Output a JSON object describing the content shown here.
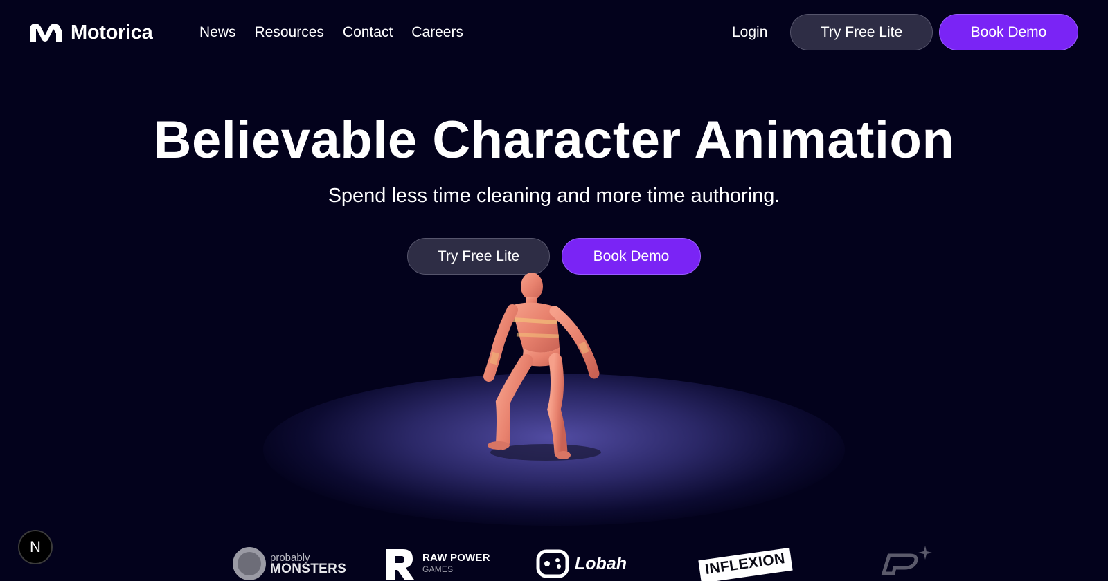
{
  "brand": {
    "name": "Motorica"
  },
  "nav": {
    "items": [
      {
        "label": "News"
      },
      {
        "label": "Resources"
      },
      {
        "label": "Contact"
      },
      {
        "label": "Careers"
      }
    ],
    "login_label": "Login",
    "try_label": "Try Free Lite",
    "demo_label": "Book Demo"
  },
  "hero": {
    "title": "Believable Character Animation",
    "subtitle": "Spend less time cleaning and more time authoring.",
    "try_label": "Try Free Lite",
    "demo_label": "Book Demo"
  },
  "badge": {
    "label": "N"
  },
  "partners": {
    "monsters_small": "probably",
    "monsters_big": "MONSTERS",
    "raw_power": "RAW POWER",
    "raw_sub": "GAMES",
    "lobah": "Lobah",
    "inflexion": "INFLEXION"
  },
  "colors": {
    "background": "#03021c",
    "primary": "#7a24f5",
    "ghost": "#2e2d45",
    "text": "#ffffff"
  }
}
